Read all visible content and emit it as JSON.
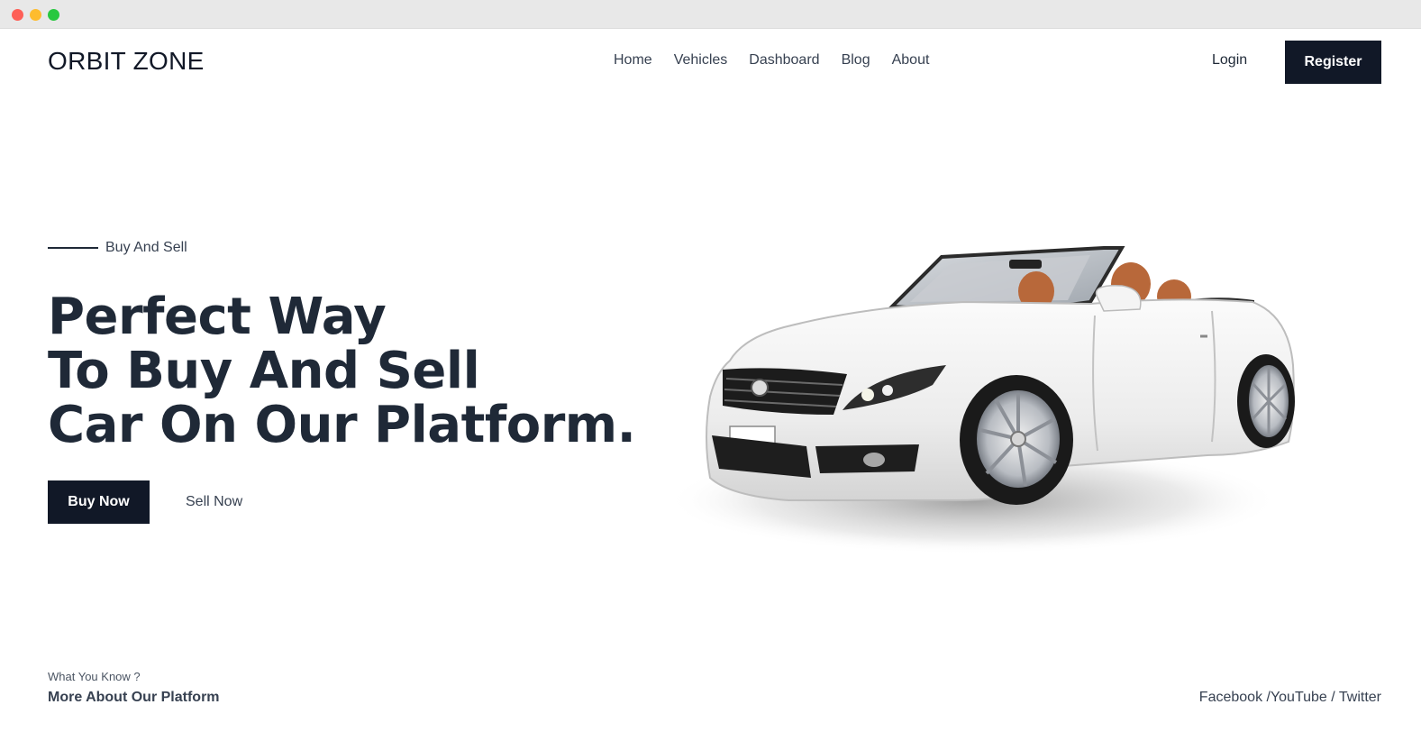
{
  "header": {
    "logo": "ORBIT ZONE",
    "nav": [
      "Home",
      "Vehicles",
      "Dashboard",
      "Blog",
      "About"
    ],
    "login": "Login",
    "register": "Register"
  },
  "hero": {
    "eyebrow": "Buy And Sell",
    "headline": [
      "Perfect Way",
      "To Buy And Sell",
      "Car On Our Platform."
    ],
    "buy_now": "Buy Now",
    "sell_now": "Sell Now"
  },
  "footer": {
    "question": "What You Know ?",
    "more": "More About Our Platform",
    "social": [
      "Facebook",
      "YouTube",
      "Twitter"
    ]
  }
}
